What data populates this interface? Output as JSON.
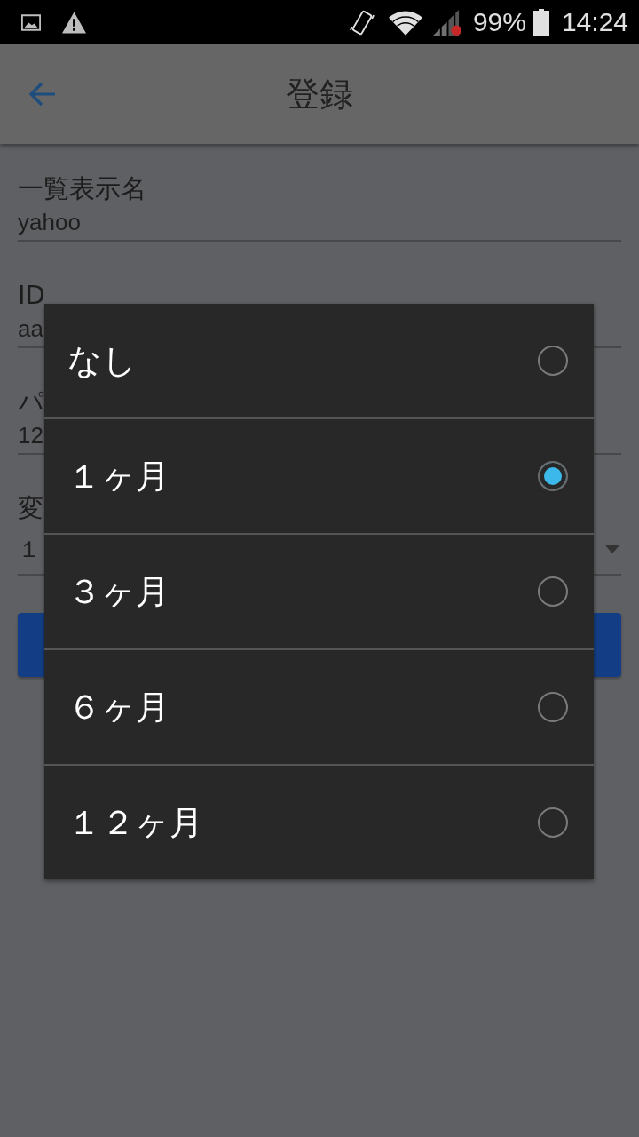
{
  "status_bar": {
    "battery": "99%",
    "time": "14:24"
  },
  "app_bar": {
    "title": "登録"
  },
  "form": {
    "fields": [
      {
        "kind": "text",
        "label": "一覧表示名",
        "value": "yahoo"
      },
      {
        "kind": "text",
        "label": "ID",
        "value": "aa"
      },
      {
        "kind": "text",
        "label": "パ",
        "value": "12"
      },
      {
        "kind": "dropdown",
        "label": "変",
        "value": "１"
      }
    ]
  },
  "dialog": {
    "options": [
      {
        "label": "なし",
        "selected": false
      },
      {
        "label": "１ヶ月",
        "selected": true
      },
      {
        "label": "３ヶ月",
        "selected": false
      },
      {
        "label": "６ヶ月",
        "selected": false
      },
      {
        "label": "１２ヶ月",
        "selected": false
      }
    ]
  }
}
